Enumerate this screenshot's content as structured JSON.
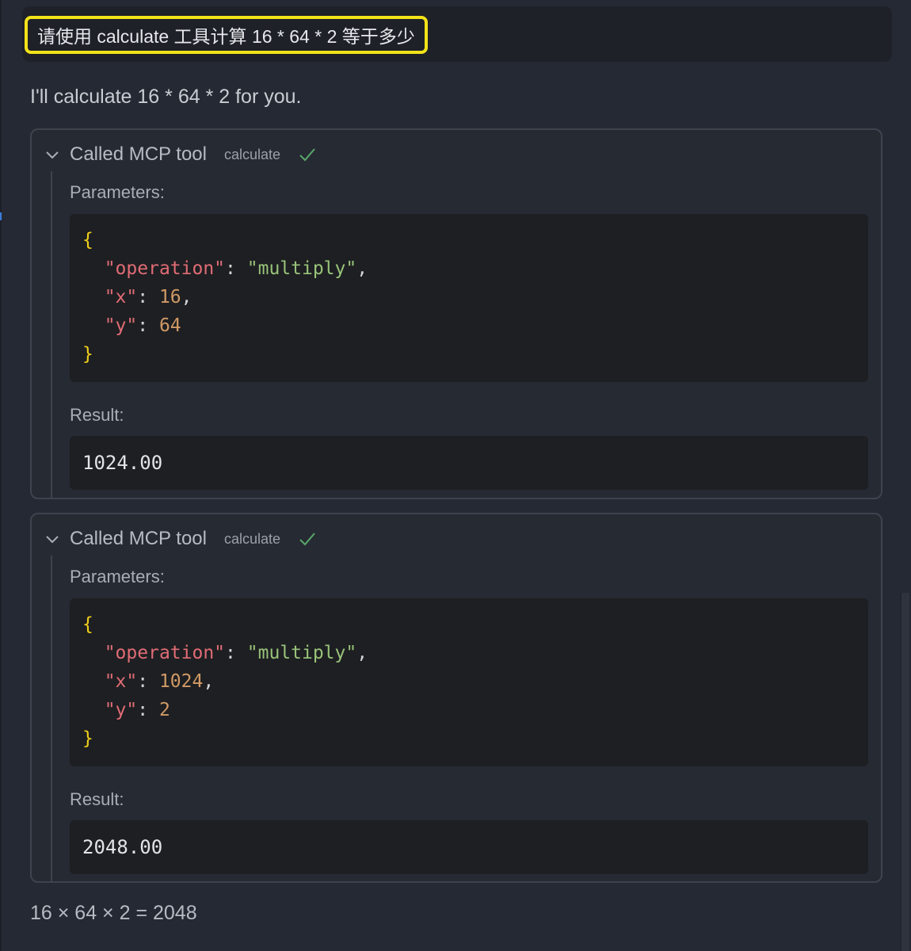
{
  "user_message": "请使用 calculate 工具计算 16 * 64 * 2 等于多少",
  "assistant_intro": "I'll calculate 16 * 64 * 2 for you.",
  "tool_calls": [
    {
      "title": "Called MCP tool",
      "tool_name": "calculate",
      "status_icon": "checkmark-icon",
      "parameters_label": "Parameters:",
      "params": {
        "operation": "multiply",
        "x": "16",
        "y": "64"
      },
      "result_label": "Result:",
      "result": "1024.00"
    },
    {
      "title": "Called MCP tool",
      "tool_name": "calculate",
      "status_icon": "checkmark-icon",
      "parameters_label": "Parameters:",
      "params": {
        "operation": "multiply",
        "x": "1024",
        "y": "2"
      },
      "result_label": "Result:",
      "result": "2048.00"
    }
  ],
  "final_answer": "16 × 64 × 2 = 2048",
  "colors": {
    "highlight_border": "#f3e318",
    "json_brace": "#f1cf1a",
    "json_key": "#e06c75",
    "json_string": "#98c379",
    "json_number": "#d19a66",
    "success_check": "#5aa86b"
  }
}
